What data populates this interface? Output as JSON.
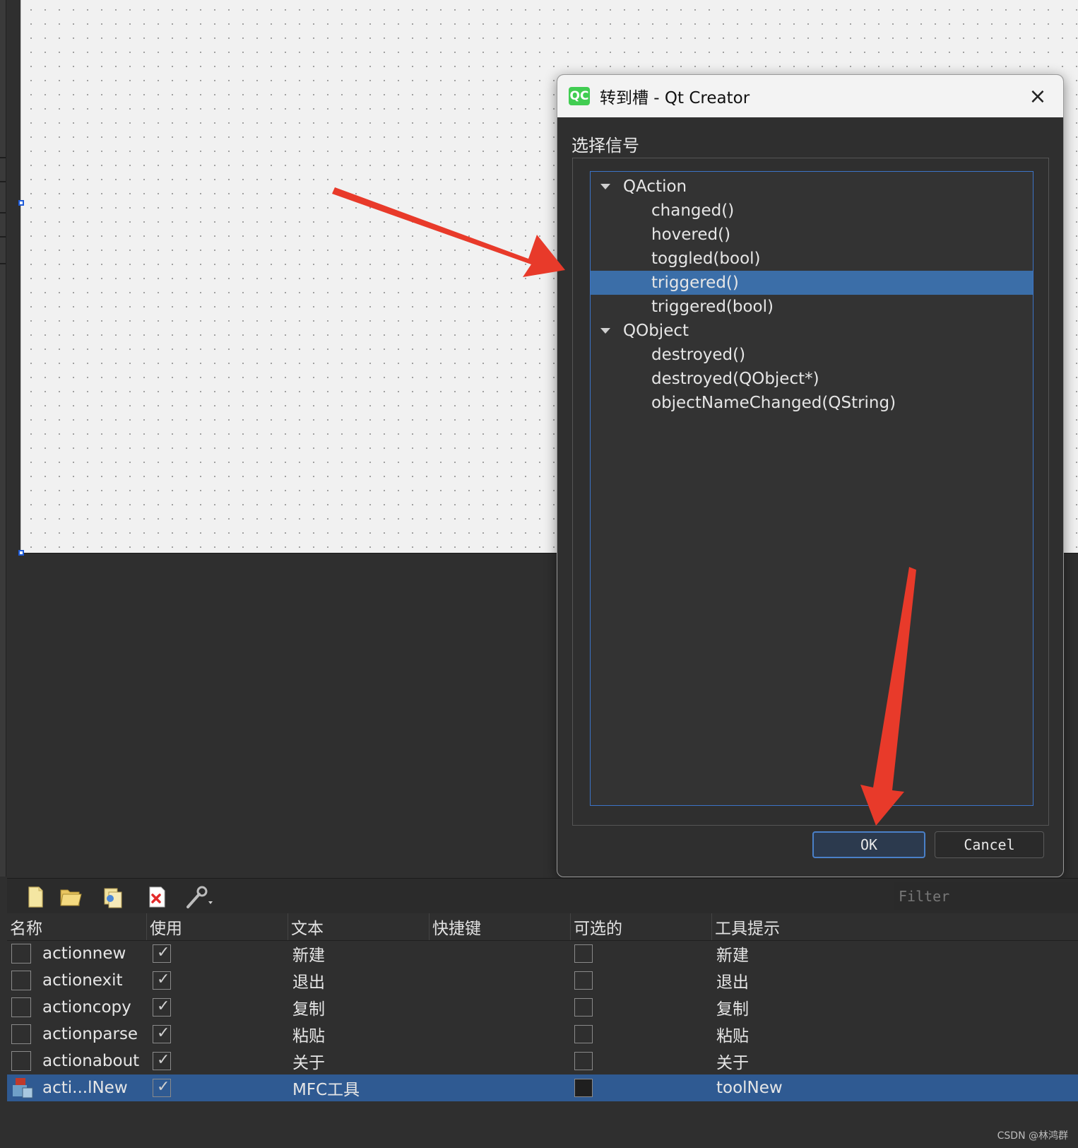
{
  "dialog": {
    "title": "转到槽 - Qt Creator",
    "logo_text": "QC",
    "close_icon": "×",
    "signal_label": "选择信号",
    "ok_label": "OK",
    "cancel_label": "Cancel",
    "tree": [
      {
        "label": "QAction",
        "level": 0,
        "expanded": true,
        "selected": false
      },
      {
        "label": "changed()",
        "level": 1,
        "selected": false
      },
      {
        "label": "hovered()",
        "level": 1,
        "selected": false
      },
      {
        "label": "toggled(bool)",
        "level": 1,
        "selected": false
      },
      {
        "label": "triggered()",
        "level": 1,
        "selected": true
      },
      {
        "label": "triggered(bool)",
        "level": 1,
        "selected": false
      },
      {
        "label": "QObject",
        "level": 0,
        "expanded": true,
        "selected": false
      },
      {
        "label": "destroyed()",
        "level": 1,
        "selected": false
      },
      {
        "label": "destroyed(QObject*)",
        "level": 1,
        "selected": false
      },
      {
        "label": "objectNameChanged(QString)",
        "level": 1,
        "selected": false
      }
    ]
  },
  "action_editor": {
    "filter_placeholder": "Filter",
    "toolbar_icons": [
      "new-action-icon",
      "open-folder-icon",
      "copy-icon",
      "delete-icon",
      "configure-icon"
    ],
    "headers": [
      "名称",
      "使用",
      "文本",
      "快捷键",
      "可选的",
      "工具提示"
    ],
    "rows": [
      {
        "name": "actionnew",
        "used": true,
        "text": "新建",
        "shortcut": "",
        "checkable": false,
        "tooltip": "新建",
        "selected": false,
        "icon": false
      },
      {
        "name": "actionexit",
        "used": true,
        "text": "退出",
        "shortcut": "",
        "checkable": false,
        "tooltip": "退出",
        "selected": false,
        "icon": false
      },
      {
        "name": "actioncopy",
        "used": true,
        "text": "复制",
        "shortcut": "",
        "checkable": false,
        "tooltip": "复制",
        "selected": false,
        "icon": false
      },
      {
        "name": "actionparse",
        "used": true,
        "text": "粘贴",
        "shortcut": "",
        "checkable": false,
        "tooltip": "粘贴",
        "selected": false,
        "icon": false
      },
      {
        "name": "actionabout",
        "used": true,
        "text": "关于",
        "shortcut": "",
        "checkable": false,
        "tooltip": "关于",
        "selected": false,
        "icon": false
      },
      {
        "name": "acti...lNew",
        "used": true,
        "text": "MFC工具",
        "shortcut": "",
        "checkable": false,
        "tooltip": "toolNew",
        "selected": true,
        "icon": true
      }
    ]
  },
  "credit": "CSDN @林鸿群",
  "colors": {
    "arrow": "#e83a2a",
    "selection": "#3b6ea8",
    "qt_green": "#41cd52"
  }
}
